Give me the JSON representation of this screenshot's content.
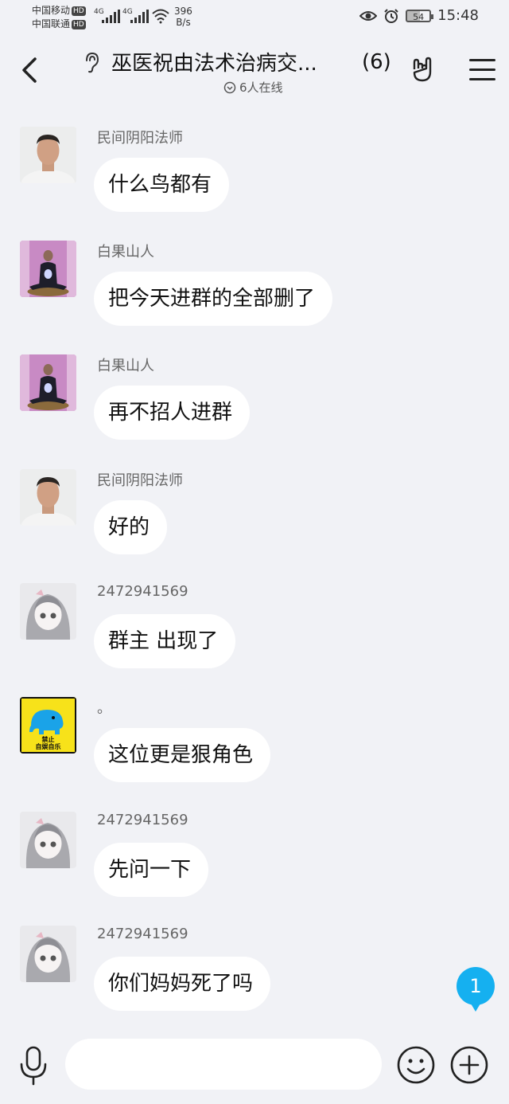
{
  "status": {
    "carrier1": "中国移动",
    "carrier2": "中国联通",
    "hd": "HD",
    "signal_type": "4G",
    "net_speed": "396",
    "net_unit": "B/s",
    "battery": "54",
    "time": "15:48"
  },
  "header": {
    "title": "巫医祝由法术治病交...",
    "member_count": "(6)",
    "online": "6人在线"
  },
  "messages": [
    {
      "sender": "民间阴阳法师",
      "text": "什么鸟都有",
      "avatar": "man-photo"
    },
    {
      "sender": "白果山人",
      "text": "把今天进群的全部删了",
      "avatar": "meditation-photo"
    },
    {
      "sender": "白果山人",
      "text": "再不招人进群",
      "avatar": "meditation-photo"
    },
    {
      "sender": "民间阴阳法师",
      "text": "好的",
      "avatar": "man-photo"
    },
    {
      "sender": "2472941569",
      "text": "群主 出现了",
      "avatar": "anime-girl"
    },
    {
      "sender": "。",
      "text": "这位更是狠角色",
      "avatar": "elephant-sign"
    },
    {
      "sender": "2472941569",
      "text": "先问一下",
      "avatar": "anime-girl"
    },
    {
      "sender": "2472941569",
      "text": "你们妈妈死了吗",
      "avatar": "anime-girl"
    }
  ],
  "elephant_sign_text": [
    "禁止",
    "自娱自乐"
  ],
  "unread_count": "1",
  "input": {
    "placeholder": ""
  },
  "colors": {
    "background": "#f1f2f6",
    "bubble": "#ffffff",
    "unread_badge": "#15b0f0"
  }
}
